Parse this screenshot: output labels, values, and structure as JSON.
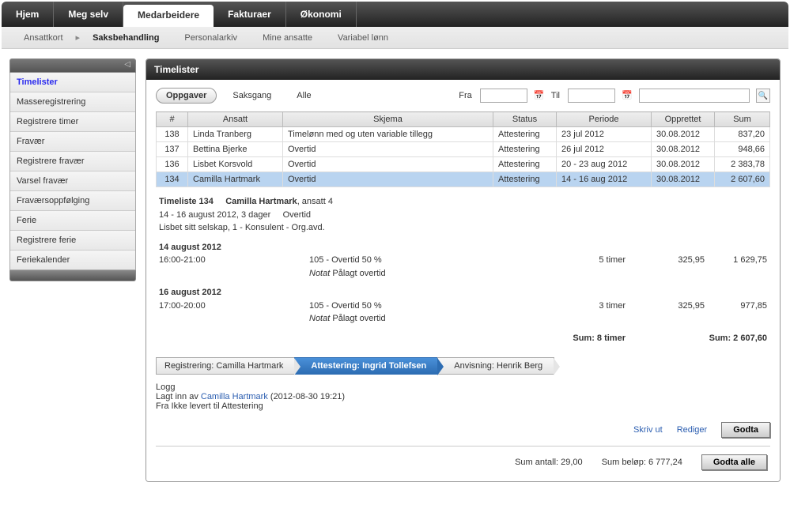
{
  "topnav": {
    "tabs": [
      {
        "label": "Hjem"
      },
      {
        "label": "Meg selv"
      },
      {
        "label": "Medarbeidere",
        "active": true
      },
      {
        "label": "Fakturaer"
      },
      {
        "label": "Økonomi"
      }
    ]
  },
  "subnav": {
    "items": [
      {
        "label": "Ansattkort"
      },
      {
        "label": "Saksbehandling",
        "current": true
      },
      {
        "label": "Personalarkiv"
      },
      {
        "label": "Mine ansatte"
      },
      {
        "label": "Variabel lønn"
      }
    ]
  },
  "sidebar": {
    "items": [
      {
        "label": "Timelister",
        "active": true
      },
      {
        "label": "Masseregistrering"
      },
      {
        "label": "Registrere timer"
      },
      {
        "label": "Fravær"
      },
      {
        "label": "Registrere fravær"
      },
      {
        "label": "Varsel fravær"
      },
      {
        "label": "Fraværsoppfølging"
      },
      {
        "label": "Ferie"
      },
      {
        "label": "Registrere ferie"
      },
      {
        "label": "Feriekalender"
      }
    ]
  },
  "content": {
    "title": "Timelister",
    "tabs": {
      "oppgaver": "Oppgaver",
      "saksgang": "Saksgang",
      "alle": "Alle"
    },
    "filter": {
      "fra_label": "Fra",
      "til_label": "Til"
    },
    "columns": {
      "num": "#",
      "ansatt": "Ansatt",
      "skjema": "Skjema",
      "status": "Status",
      "periode": "Periode",
      "opprettet": "Opprettet",
      "sum": "Sum"
    },
    "rows": [
      {
        "num": "138",
        "ansatt": "Linda Tranberg",
        "skjema": "Timelønn med og uten variable tillegg",
        "status": "Attestering",
        "periode": "23 jul 2012",
        "opprettet": "30.08.2012",
        "sum": "837,20"
      },
      {
        "num": "137",
        "ansatt": "Bettina Bjerke",
        "skjema": "Overtid",
        "status": "Attestering",
        "periode": "26 jul 2012",
        "opprettet": "30.08.2012",
        "sum": "948,66"
      },
      {
        "num": "136",
        "ansatt": "Lisbet Korsvold",
        "skjema": "Overtid",
        "status": "Attestering",
        "periode": "20 - 23 aug 2012",
        "opprettet": "30.08.2012",
        "sum": "2 383,78"
      },
      {
        "num": "134",
        "ansatt": "Camilla Hartmark",
        "skjema": "Overtid",
        "status": "Attestering",
        "periode": "14 - 16 aug 2012",
        "opprettet": "30.08.2012",
        "sum": "2 607,60",
        "selected": true
      }
    ],
    "detail": {
      "heading_a": "Timeliste 134",
      "heading_b": "Camilla Hartmark",
      "heading_c": ", ansatt 4",
      "period": "14 - 16 august 2012, 3 dager",
      "scheme": "Overtid",
      "org": "Lisbet sitt selskap, 1 - Konsulent - Org.avd.",
      "days": [
        {
          "date": "14 august 2012",
          "time": "16:00-21:00",
          "code": "105 - Overtid 50 %",
          "note_label": "Notat",
          "note": "Pålagt overtid",
          "hours": "5 timer",
          "rate": "325,95",
          "amount": "1 629,75"
        },
        {
          "date": "16 august 2012",
          "time": "17:00-20:00",
          "code": "105 - Overtid 50 %",
          "note_label": "Notat",
          "note": "Pålagt overtid",
          "hours": "3 timer",
          "rate": "325,95",
          "amount": "977,85"
        }
      ],
      "sum_hours": "Sum: 8 timer",
      "sum_amount": "Sum: 2 607,60"
    },
    "workflow": [
      {
        "label": "Registrering: Camilla Hartmark"
      },
      {
        "label": "Attestering: Ingrid Tollefsen",
        "active": true
      },
      {
        "label": "Anvisning: Henrik Berg"
      }
    ],
    "log": {
      "title": "Logg",
      "line1a": "Lagt inn av ",
      "line1b": "Camilla Hartmark",
      "line1c": " (2012-08-30 19:21)",
      "line2": "Fra Ikke levert til Attestering"
    },
    "actions": {
      "print": "Skriv ut",
      "edit": "Rediger",
      "accept": "Godta"
    },
    "footer": {
      "sum_antall": "Sum antall: 29,00",
      "sum_belop": "Sum beløp: 6 777,24",
      "accept_all": "Godta alle"
    }
  }
}
